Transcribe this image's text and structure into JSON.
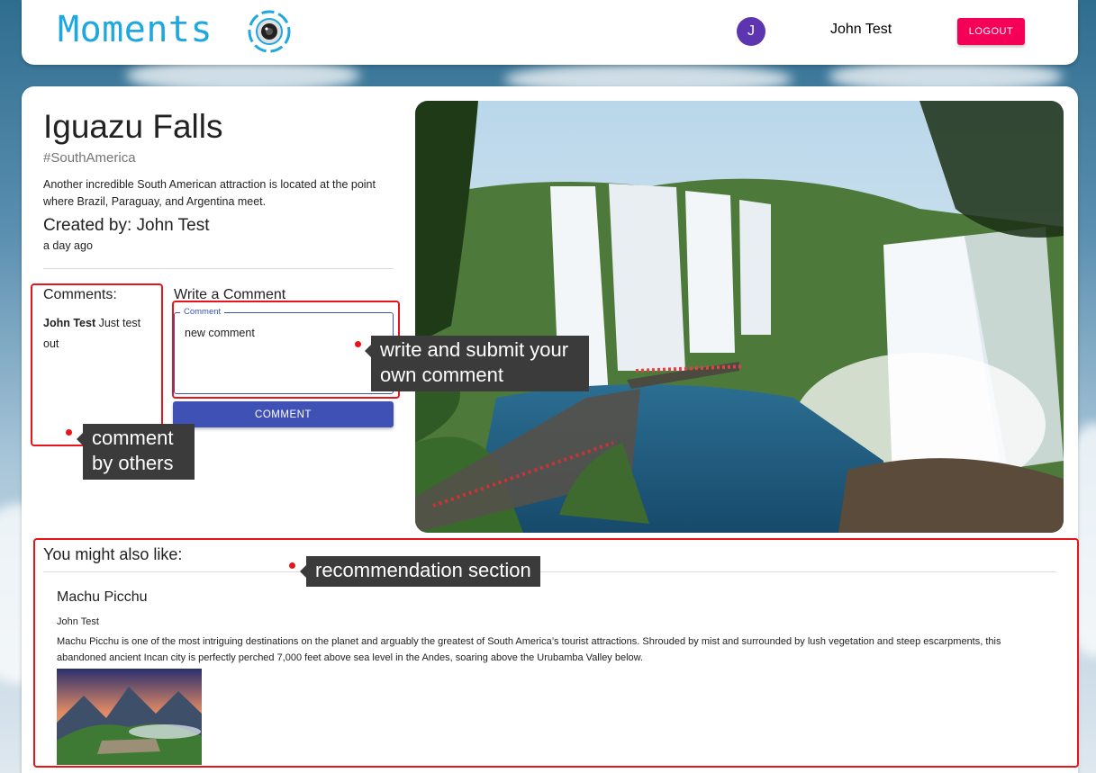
{
  "header": {
    "brand": "Moments",
    "avatar_initial": "J",
    "username": "John Test",
    "logout_label": "LOGOUT"
  },
  "post": {
    "title": "Iguazu Falls",
    "tag": "#SouthAmerica",
    "description": "Another incredible South American attraction is located at the point where Brazil, Paraguay, and Argentina meet.",
    "created_by": "Created by: John Test",
    "time_ago": "a day ago"
  },
  "comments": {
    "heading": "Comments:",
    "items": [
      {
        "author": "John Test",
        "text": "Just test out"
      }
    ]
  },
  "write_comment": {
    "heading": "Write a Comment",
    "field_label": "Comment",
    "value": "new comment",
    "button_label": "COMMENT"
  },
  "recommendations": {
    "heading": "You might also like:",
    "items": [
      {
        "title": "Machu Picchu",
        "author": "John Test",
        "description": "Machu Picchu is one of the most intriguing destinations on the planet and arguably the greatest of South America’s tourist attractions. Shrouded by mist and surrounded by lush vegetation and steep escarpments, this abandoned ancient Incan city is perfectly perched 7,000 feet above sea level in the Andes, soaring above the Urubamba Valley below."
      }
    ]
  },
  "annotations": {
    "comments_by_others": "comment by others",
    "write_own": "write and submit your own comment",
    "recommendation": "recommendation section"
  },
  "colors": {
    "brand": "#1ea7e0",
    "avatar": "#5e35b1",
    "logout": "#f50057",
    "primary": "#3f51b5",
    "highlight": "#e8141b"
  }
}
